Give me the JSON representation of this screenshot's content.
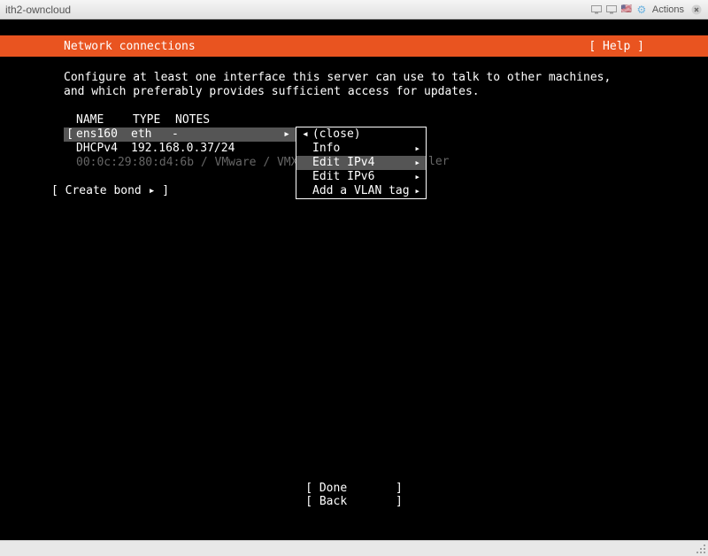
{
  "window": {
    "title": "ith2-owncloud",
    "actions_label": "Actions"
  },
  "header": {
    "title": "Network connections",
    "help": "[ Help ]"
  },
  "description": "Configure at least one interface this server can use to talk to other machines,\nand which preferably provides sufficient access for updates.",
  "columns": {
    "name": "NAME",
    "type": "TYPE",
    "notes": "NOTES"
  },
  "iface": {
    "name": "ens160",
    "type": "eth",
    "notes": "-",
    "dhcp_label": "DHCPv4",
    "dhcp_value": "192.168.0.37/24",
    "mac_line": "00:0c:29:80:d4:6b / VMware / VMX",
    "truncated_tail": "ler"
  },
  "create_bond": "[ Create bond ▸ ]",
  "popup": {
    "items": [
      {
        "label": "(close)",
        "left_arrow": true,
        "right_arrow": false,
        "selected": false
      },
      {
        "label": "Info",
        "left_arrow": false,
        "right_arrow": true,
        "selected": false
      },
      {
        "label": "Edit IPv4",
        "left_arrow": false,
        "right_arrow": true,
        "selected": true
      },
      {
        "label": "Edit IPv6",
        "left_arrow": false,
        "right_arrow": true,
        "selected": false
      },
      {
        "label": "Add a VLAN tag",
        "left_arrow": false,
        "right_arrow": true,
        "selected": false
      }
    ]
  },
  "footer": {
    "done": "[ Done       ]",
    "back": "[ Back       ]"
  }
}
